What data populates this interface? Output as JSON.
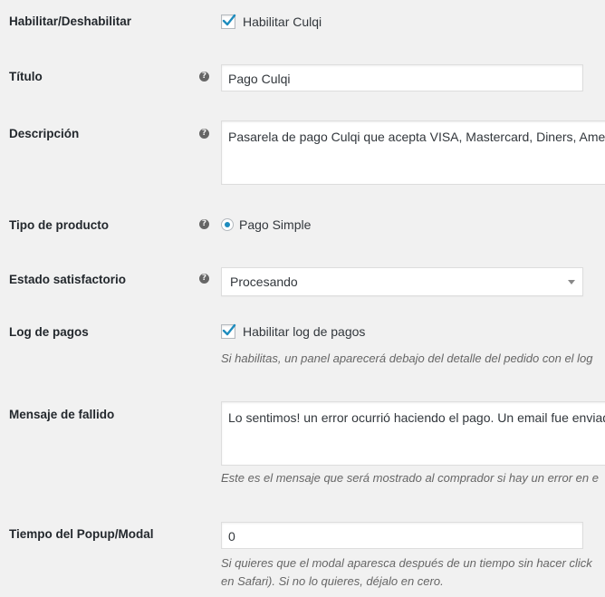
{
  "fields": {
    "enable": {
      "label": "Habilitar/Deshabilitar",
      "checkbox_label": "Habilitar Culqi",
      "checked": true
    },
    "title": {
      "label": "Título",
      "value": "Pago Culqi"
    },
    "description": {
      "label": "Descripción",
      "value": "Pasarela de pago Culqi que acepta VISA, Mastercard, Diners, Americ"
    },
    "product_type": {
      "label": "Tipo de producto",
      "radio_label": "Pago Simple",
      "selected": true
    },
    "success_state": {
      "label": "Estado satisfactorio",
      "selected_value": "Procesando"
    },
    "payment_log": {
      "label": "Log de pagos",
      "checkbox_label": "Habilitar log de pagos",
      "checked": true,
      "description": "Si habilitas, un panel aparecerá debajo del detalle del pedido con el log"
    },
    "failure_message": {
      "label": "Mensaje de fallido",
      "value": "Lo sentimos! un error ocurrió haciendo el pago. Un email fue enviad",
      "description": "Este es el mensaje que será mostrado al comprador si hay un error en e"
    },
    "popup_time": {
      "label": "Tiempo del Popup/Modal",
      "value": "0",
      "description_line1": "Si quieres que el modal aparesca después de un tiempo sin hacer click",
      "description_line2": "en Safari). Si no lo quieres, déjalo en cero."
    }
  },
  "icons": {
    "help": "help-icon",
    "check": "checkmark-icon",
    "dropdown": "chevron-down-icon"
  },
  "colors": {
    "background": "#f1f1f1",
    "checkmark": "#1e8cbe",
    "radio_dot": "#1e8cbe",
    "help_icon": "#666666"
  },
  "help_glyph": "?"
}
